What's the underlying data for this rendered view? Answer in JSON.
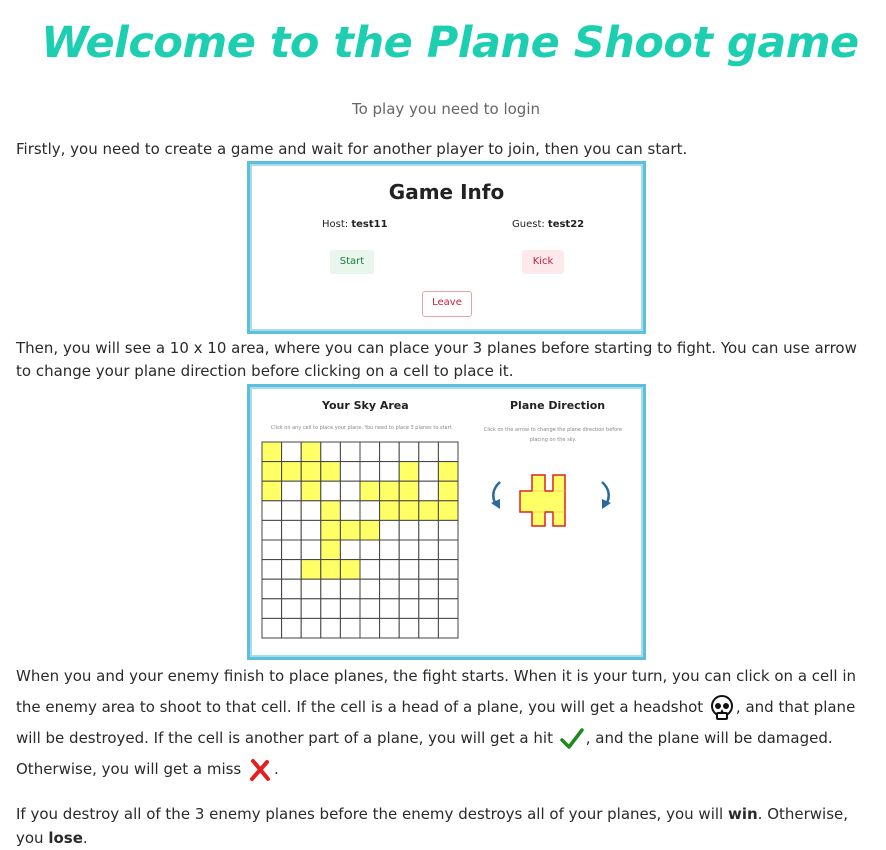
{
  "title": "Welcome to the Plane Shoot game",
  "subtitle": "To play you need to login",
  "paragraphs": {
    "p1": "Firstly, you need to create a game and wait for another player to join, then you can start.",
    "p2": "Then, you will see a 10 x 10 area, where you can place your 3 planes before starting to fight. You can use arrow to change your plane direction before clicking on a cell to place it.",
    "p3a": "When you and your enemy finish to place planes, the fight starts. When it is your turn, you can click on a cell in the enemy area to shoot to that cell. If the cell is a head of a plane, you will get a headshot",
    "p3b": ", and that plane will be destroyed. If the cell is another part of a plane, you will get a hit",
    "p3c": ", and the plane will be damaged. Otherwise, you will get a miss",
    "p3d": ".",
    "p4a": "If you destroy all of the 3 enemy planes before the enemy destroys all of your planes, you will ",
    "p4_win": "win",
    "p4b": ". Otherwise, you ",
    "p4_lose": "lose",
    "p4c": "."
  },
  "game_info": {
    "title": "Game Info",
    "host_label": "Host: ",
    "host_name": "test11",
    "guest_label": "Guest: ",
    "guest_name": "test22",
    "start_label": "Start",
    "kick_label": "Kick",
    "leave_label": "Leave"
  },
  "sky": {
    "title": "Your Sky Area",
    "hint": "Click on any cell to place your plane. You need to place 3 planes to start.",
    "direction_title": "Plane Direction",
    "direction_hint": "Click on the arrow to change the plane direction before placing on the sky.",
    "grid_rows": 10,
    "grid_cols": 10,
    "filled_cells": [
      [
        0,
        0
      ],
      [
        0,
        2
      ],
      [
        1,
        0
      ],
      [
        1,
        1
      ],
      [
        1,
        2
      ],
      [
        1,
        3
      ],
      [
        2,
        0
      ],
      [
        2,
        2
      ],
      [
        1,
        7
      ],
      [
        2,
        5
      ],
      [
        2,
        6
      ],
      [
        2,
        7
      ],
      [
        2,
        9
      ],
      [
        3,
        7
      ],
      [
        3,
        9
      ],
      [
        1,
        9
      ],
      [
        3,
        3
      ],
      [
        4,
        3
      ],
      [
        4,
        4
      ],
      [
        4,
        5
      ],
      [
        5,
        3
      ],
      [
        6,
        2
      ],
      [
        6,
        3
      ],
      [
        6,
        4
      ],
      [
        3,
        6
      ],
      [
        3,
        8
      ]
    ],
    "fill_color": "#ffff66",
    "stroke_color": "#e02020"
  },
  "icons": {
    "headshot": "skull-icon",
    "hit": "checkmark-icon",
    "miss": "cross-icon"
  },
  "colors": {
    "title": "#1ccfb0",
    "frame_border": "#5cc0dc",
    "start_text": "#1b7a3a",
    "kick_text": "#c0203a"
  }
}
